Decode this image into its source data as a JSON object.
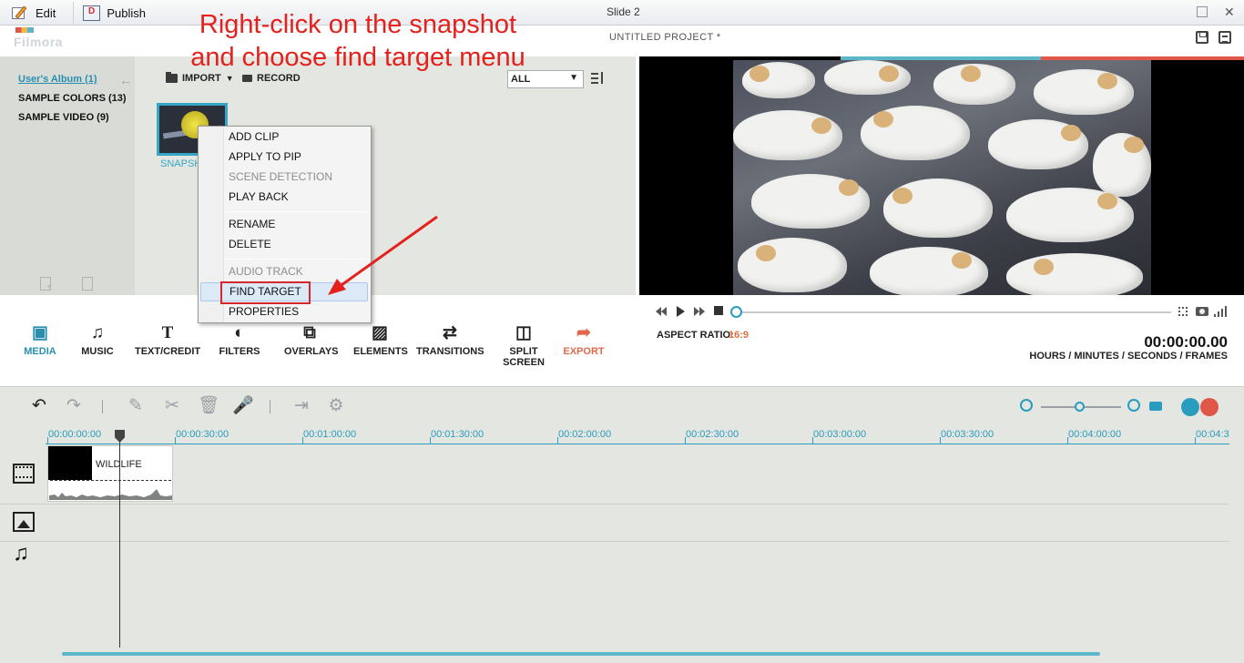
{
  "hostbar": {
    "edit_label": "Edit",
    "publish_label": "Publish",
    "slide_title": "Slide 2"
  },
  "app": {
    "logo_text": "Filmora",
    "project_title": "UNTITLED PROJECT *"
  },
  "annotation": {
    "line1": "Right-click on the snapshot",
    "line2": "and choose find target menu"
  },
  "albums": [
    {
      "label": "User's Album (1)",
      "active": true
    },
    {
      "label": "SAMPLE COLORS (13)",
      "active": false
    },
    {
      "label": "SAMPLE VIDEO (9)",
      "active": false
    }
  ],
  "library": {
    "import_label": "IMPORT",
    "record_label": "RECORD",
    "filter_value": "ALL",
    "thumb_label": "SNAPSH"
  },
  "context_menu": {
    "items": [
      {
        "label": "ADD CLIP",
        "state": "enabled"
      },
      {
        "label": "APPLY TO PIP",
        "state": "enabled"
      },
      {
        "label": "SCENE DETECTION",
        "state": "disabled"
      },
      {
        "label": "PLAY BACK",
        "state": "enabled"
      },
      {
        "label": "RENAME",
        "state": "enabled"
      },
      {
        "label": "DELETE",
        "state": "enabled"
      },
      {
        "label": "AUDIO TRACK",
        "state": "disabled"
      },
      {
        "label": "FIND TARGET",
        "state": "hover"
      },
      {
        "label": "PROPERTIES",
        "state": "enabled"
      }
    ]
  },
  "preview": {
    "aspect_label": "ASPECT RATIO:",
    "aspect_value": "16:9",
    "timecode": "00:00:00.00",
    "timecode_units": "HOURS / MINUTES / SECONDS / FRAMES",
    "seek_progress": 0
  },
  "toolbar": [
    {
      "label": "MEDIA",
      "icon": "media-icon",
      "state": "active"
    },
    {
      "label": "MUSIC",
      "icon": "music-icon",
      "state": "normal"
    },
    {
      "label": "TEXT/CREDIT",
      "icon": "text-icon",
      "state": "normal"
    },
    {
      "label": "FILTERS",
      "icon": "filters-icon",
      "state": "normal"
    },
    {
      "label": "OVERLAYS",
      "icon": "overlays-icon",
      "state": "normal"
    },
    {
      "label": "ELEMENTS",
      "icon": "elements-icon",
      "state": "normal"
    },
    {
      "label": "TRANSITIONS",
      "icon": "transitions-icon",
      "state": "normal"
    },
    {
      "label": "SPLIT SCREEN",
      "icon": "split-screen-icon",
      "state": "normal"
    },
    {
      "label": "EXPORT",
      "icon": "export-icon",
      "state": "accent"
    }
  ],
  "timeline": {
    "ruler_labels": [
      "00:00:00:00",
      "00:00:30:00",
      "00:01:00:00",
      "00:01:30:00",
      "00:02:00:00",
      "00:02:30:00",
      "00:03:00:00",
      "00:03:30:00",
      "00:04:00:00",
      "00:04:3"
    ],
    "clip_name": "WILDLIFE"
  },
  "colors": {
    "accent_teal": "#2a9cbd",
    "annotation_red": "#e4211c",
    "export_orange": "#e0694c",
    "aspect_orange": "#e0703e"
  }
}
